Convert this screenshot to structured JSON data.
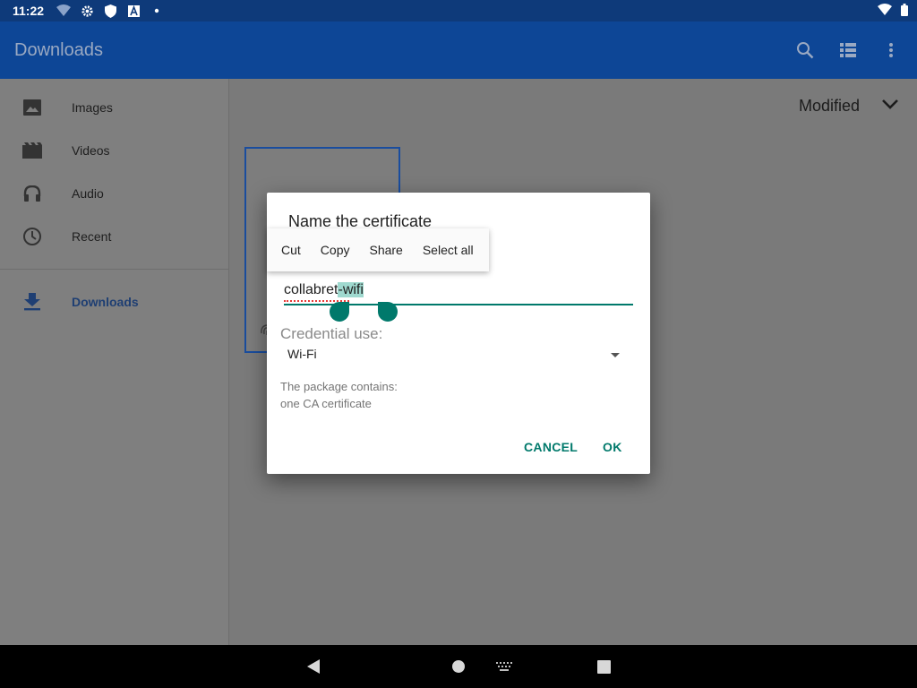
{
  "status_bar": {
    "time": "11:22",
    "left_icons": [
      "wifi-question-icon",
      "gear-icon",
      "shield-icon",
      "a-badge-icon",
      "dot-icon"
    ],
    "right_icons": [
      "wifi-icon",
      "battery-icon"
    ]
  },
  "app_bar": {
    "title": "Downloads",
    "actions": [
      "search-icon",
      "list-view-icon",
      "more-vert-icon"
    ]
  },
  "drawer": {
    "items": [
      {
        "label": "Images",
        "icon": "image-icon"
      },
      {
        "label": "Videos",
        "icon": "video-icon"
      },
      {
        "label": "Audio",
        "icon": "headphones-icon"
      },
      {
        "label": "Recent",
        "icon": "clock-icon"
      },
      {
        "label": "Downloads",
        "icon": "download-icon",
        "active": true
      }
    ]
  },
  "main": {
    "sort_label": "Modified"
  },
  "dialog": {
    "title": "Name the certificate",
    "text_menu": {
      "cut": "Cut",
      "copy": "Copy",
      "share": "Share",
      "select_all": "Select all"
    },
    "name_field": {
      "before_selection": "collabr",
      "cursor_text": "",
      "middle": "et",
      "selected": "-wifi",
      "value": "collabret-wifi"
    },
    "credential_label": "Credential use:",
    "credential_value": "Wi-Fi",
    "package_line1": "The package contains:",
    "package_line2": "one CA certificate",
    "cancel_label": "CANCEL",
    "ok_label": "OK"
  },
  "colors": {
    "status_bar": "#0e3a7a",
    "app_bar": "#0d4696",
    "accent": "#00796b",
    "selection": "#9fd9cf"
  }
}
